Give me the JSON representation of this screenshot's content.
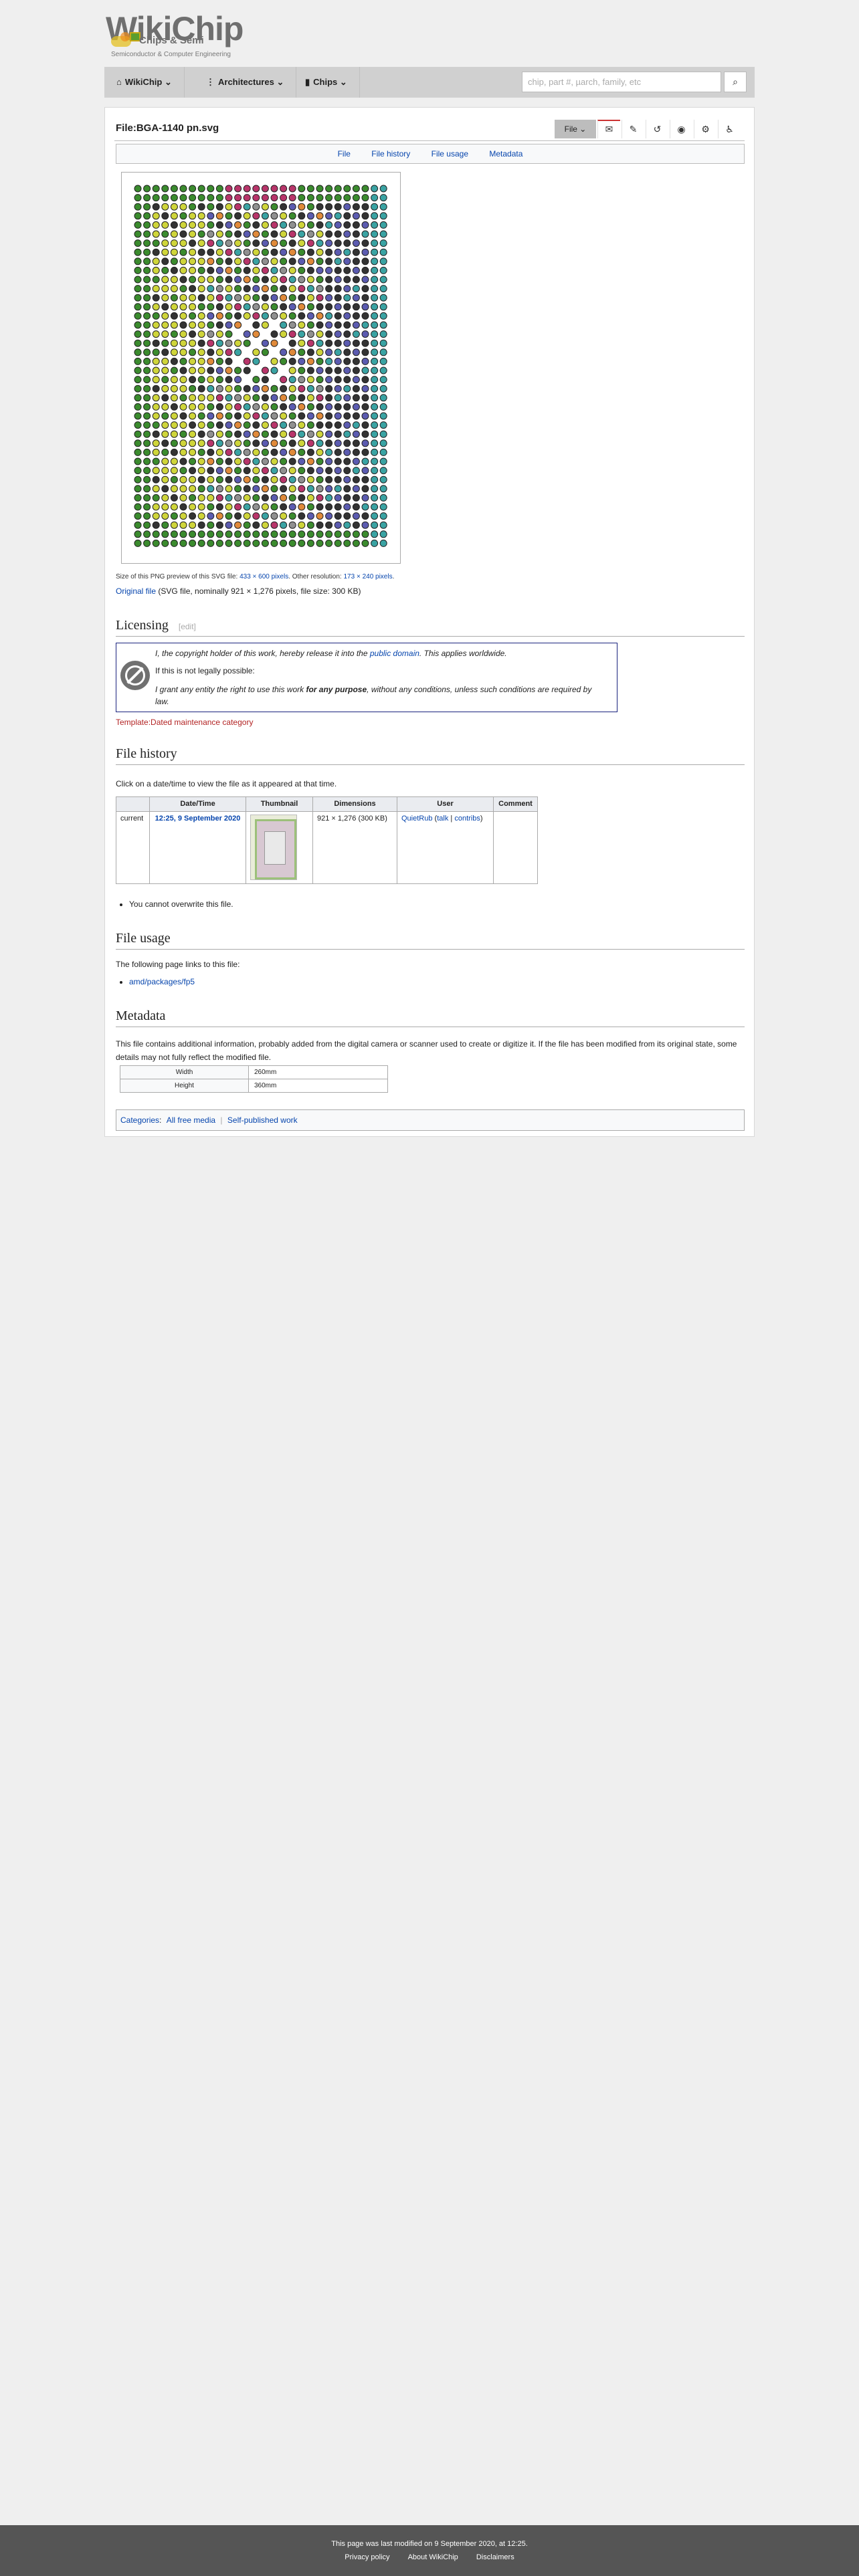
{
  "site": {
    "logo_word": "WikiChip",
    "logo_sub": "Chips & Semi",
    "tagline": "Semiconductor & Computer Engineering"
  },
  "nav": {
    "items": [
      {
        "label": "WikiChip",
        "icon": "home-icon"
      },
      {
        "label": "Architectures",
        "icon": "architecture-icon"
      },
      {
        "label": "Chips",
        "icon": "chip-icon"
      }
    ],
    "search_placeholder": "chip, part #, µarch, family, etc"
  },
  "page": {
    "title": "File:BGA-1140 pn.svg",
    "file_button": "File",
    "toolbar_icons": [
      "discussion-icon",
      "edit-icon",
      "history-icon",
      "watch-icon",
      "more-icon",
      "accessibility-icon"
    ]
  },
  "filetoc": {
    "items": [
      "File",
      "File history",
      "File usage",
      "Metadata"
    ]
  },
  "preview": {
    "size_text": "Size of this PNG preview of this SVG file:",
    "size_link": "433 × 600 pixels",
    "other_res_text": "Other resolution:",
    "other_res_link": "173 × 240 pixels",
    "original_link": "Original file",
    "original_info": "(SVG file, nominally 921 × 1,276 pixels, file size: 300 KB)"
  },
  "licensing": {
    "heading": "Licensing",
    "edit": "[edit]",
    "line1_pre": "I, the copyright holder of this work, hereby release it into the",
    "line1_link": "public domain",
    "line1_post": ". This applies worldwide.",
    "line2": "If this is not legally possible:",
    "line3_pre": "I grant any entity the right to use this work",
    "line3_bold": "for any purpose",
    "line3_post": ", without any conditions, unless such conditions are required by",
    "line3_end": "law.",
    "template_link": "Template:Dated maintenance category"
  },
  "history": {
    "heading": "File history",
    "intro": "Click on a date/time to view the file as it appeared at that time.",
    "columns": [
      "",
      "Date/Time",
      "Thumbnail",
      "Dimensions",
      "User",
      "Comment"
    ],
    "row": {
      "status": "current",
      "datetime": "12:25, 9 September 2020",
      "dimensions": "921 × 1,276 (300 KB)",
      "user": "QuietRub",
      "talk": "talk",
      "contribs": "contribs",
      "comment": ""
    },
    "note": "You cannot overwrite this file."
  },
  "usage": {
    "heading": "File usage",
    "intro": "The following page links to this file:",
    "link": "amd/packages/fp5"
  },
  "metadata": {
    "heading": "Metadata",
    "intro": "This file contains additional information, probably added from the digital camera or scanner used to create or digitize it. If the file has been modified from its original state, some details may not fully reflect the modified file.",
    "rows": [
      {
        "key": "Width",
        "value": "260mm"
      },
      {
        "key": "Height",
        "value": "360mm"
      }
    ]
  },
  "categories": {
    "label": "Categories",
    "items": [
      "All free media",
      "Self-published work"
    ]
  },
  "footer": {
    "modified": "This page was last modified on 9 September 2020, at 12:25.",
    "links": [
      "Privacy policy",
      "About WikiChip",
      "Disclaimers"
    ]
  }
}
